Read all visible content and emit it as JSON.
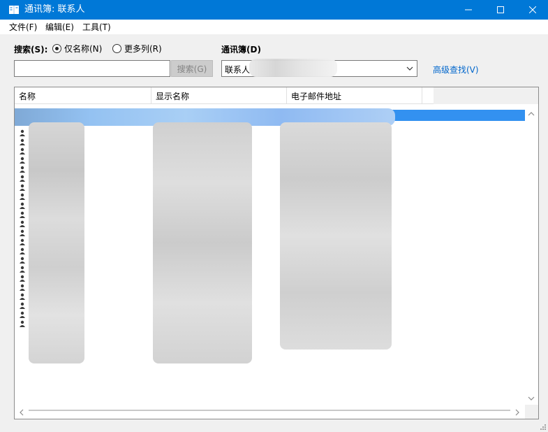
{
  "window": {
    "title": "通讯簿: 联系人"
  },
  "menu": {
    "items": [
      "文件(F)",
      "编辑(E)",
      "工具(T)"
    ]
  },
  "search": {
    "label": "搜索(S):",
    "option_name_only": "仅名称(N)",
    "option_more_columns": "更多列(R)",
    "selected_option": "仅名称(N)",
    "input_value": "",
    "button_label": "搜索(G)"
  },
  "address_book": {
    "label": "通讯簿(D)",
    "selected_value": "联系人"
  },
  "advanced_find": {
    "label": "高级查找(V)"
  },
  "list": {
    "columns": [
      "名称",
      "显示名称",
      "电子邮件地址"
    ]
  },
  "colors": {
    "titlebar": "#0078d7",
    "selection": "#3391f0",
    "link": "#0066cc"
  }
}
